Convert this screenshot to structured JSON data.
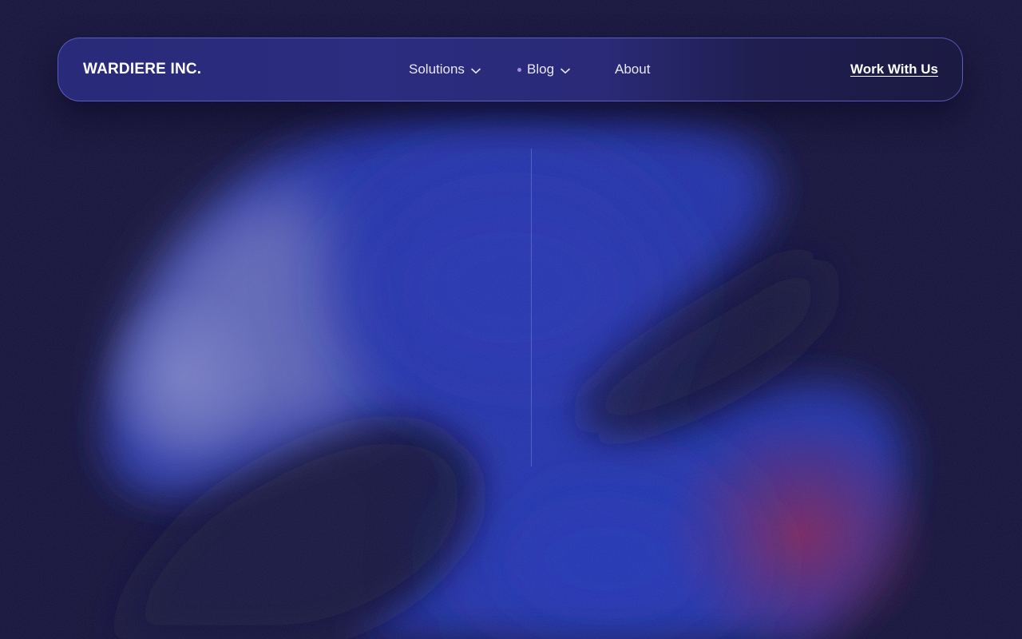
{
  "brand": {
    "name": "WARDIERE INC."
  },
  "nav": {
    "items": [
      {
        "label": "Solutions",
        "has_dropdown": true,
        "icon": "chevron-down-icon"
      },
      {
        "label": "Blog",
        "has_dropdown": true,
        "has_indicator_dot": true,
        "icon": "chevron-down-icon"
      },
      {
        "label": "About",
        "has_dropdown": false
      }
    ],
    "cta_label": "Work With Us"
  },
  "colors": {
    "background": "#14113a",
    "navbar_gradient_start": "#2a2a7a",
    "navbar_border": "#6e6edc",
    "blob_blue": "#2630a8",
    "blob_highlight": "#7f84c4",
    "blob_accent_red": "#7a2450",
    "indicator_dot": "#a58cf0"
  }
}
